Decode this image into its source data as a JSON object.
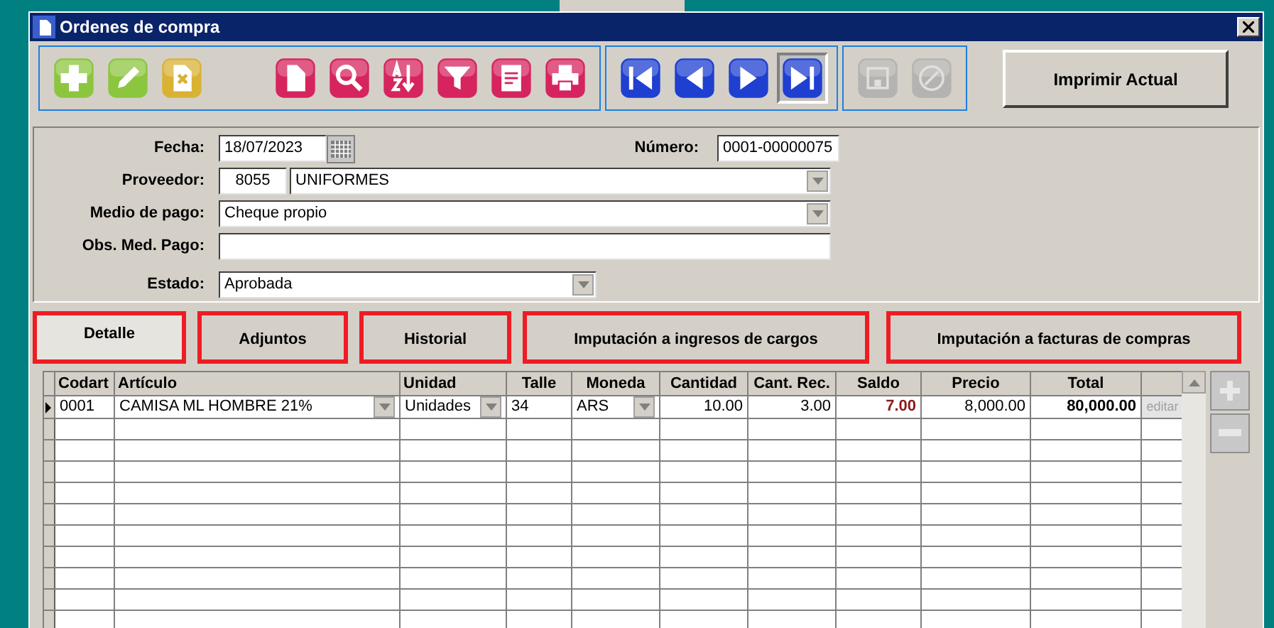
{
  "window": {
    "title": "Ordenes de compra"
  },
  "toolbar": {
    "groups": [
      [
        {
          "kind": "add",
          "color": "#8cc63f",
          "disabled": false,
          "pressed": false
        },
        {
          "kind": "edit",
          "color": "#8cc63f",
          "disabled": false,
          "pressed": false
        },
        {
          "kind": "delete",
          "color": "#d9b234",
          "disabled": false,
          "pressed": false
        }
      ],
      [
        {
          "kind": "document",
          "color": "#d6245e",
          "disabled": false,
          "pressed": false
        },
        {
          "kind": "search",
          "color": "#d6245e",
          "disabled": false,
          "pressed": false
        },
        {
          "kind": "sort",
          "color": "#d6245e",
          "disabled": false,
          "pressed": false
        },
        {
          "kind": "filter",
          "color": "#d6245e",
          "disabled": false,
          "pressed": false
        },
        {
          "kind": "notes",
          "color": "#d6245e",
          "disabled": false,
          "pressed": false
        },
        {
          "kind": "print",
          "color": "#d6245e",
          "disabled": false,
          "pressed": false
        }
      ],
      [
        {
          "kind": "first",
          "color": "#1e3fd0",
          "disabled": false,
          "pressed": false
        },
        {
          "kind": "prev",
          "color": "#1e3fd0",
          "disabled": false,
          "pressed": false
        },
        {
          "kind": "next",
          "color": "#1e3fd0",
          "disabled": false,
          "pressed": false
        },
        {
          "kind": "last",
          "color": "#1e3fd0",
          "disabled": false,
          "pressed": true
        }
      ],
      [
        {
          "kind": "save",
          "color": "#a8a8a8",
          "disabled": true,
          "pressed": false
        },
        {
          "kind": "cancel",
          "color": "#a8a8a8",
          "disabled": true,
          "pressed": false
        }
      ]
    ],
    "print_current": "Imprimir Actual"
  },
  "form": {
    "fecha_label": "Fecha:",
    "fecha": "18/07/2023",
    "numero_label": "Número:",
    "numero": "0001-00000075",
    "proveedor_label": "Proveedor:",
    "proveedor_code": "8055",
    "proveedor_name": "UNIFORMES",
    "medio_label": "Medio de pago:",
    "medio": "Cheque propio",
    "obs_label": "Obs. Med. Pago:",
    "estado_label": "Estado:",
    "estado": "Aprobada"
  },
  "tabs": [
    {
      "label": "Detalle",
      "selected": true,
      "highlighted": true
    },
    {
      "label": "Adjuntos",
      "selected": false,
      "highlighted": true
    },
    {
      "label": "Historial",
      "selected": false,
      "highlighted": true
    },
    {
      "label": "Imputación a ingresos de cargos",
      "selected": false,
      "highlighted": true
    },
    {
      "label": "Imputación a facturas de compras",
      "selected": false,
      "highlighted": true
    }
  ],
  "table": {
    "columns": [
      "Codart",
      "Artículo",
      "Unidad",
      "Talle",
      "Moneda",
      "Cantidad",
      "Cant. Rec.",
      "Saldo",
      "Precio",
      "Total"
    ],
    "rows": [
      {
        "current": true,
        "cells": [
          "0001",
          "CAMISA ML HOMBRE 21%",
          "Unidades",
          "34",
          "ARS",
          "10.00",
          "3.00",
          "7.00",
          "8,000.00",
          "80,000.00"
        ],
        "action": "editar"
      }
    ]
  }
}
